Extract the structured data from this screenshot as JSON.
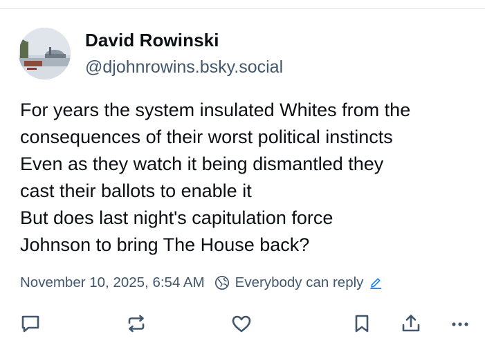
{
  "post": {
    "author": {
      "display_name": "David Rowinski",
      "handle": "@djohnrowins.bsky.social",
      "avatar_icon": "avatar"
    },
    "text_lines": [
      "For years the system insulated Whites from the",
      "consequences of their worst political instincts",
      "Even as they watch it being dismantled they",
      "cast their ballots to enable it",
      "But does last night's capitulation force",
      "Johnson to bring The House back?"
    ],
    "timestamp": "November 10, 2025, 6:54 AM",
    "reply_setting": "Everybody can reply"
  },
  "actions": [
    {
      "name": "reply",
      "icon": "comment-icon"
    },
    {
      "name": "repost",
      "icon": "repost-icon"
    },
    {
      "name": "like",
      "icon": "heart-icon"
    },
    {
      "name": "bookmark",
      "icon": "bookmark-icon"
    },
    {
      "name": "share",
      "icon": "share-icon"
    },
    {
      "name": "more",
      "icon": "more-icon"
    }
  ],
  "colors": {
    "text": "#0b0f14",
    "secondary": "#42576c",
    "accent": "#1083fe",
    "icon": "#42576c"
  }
}
